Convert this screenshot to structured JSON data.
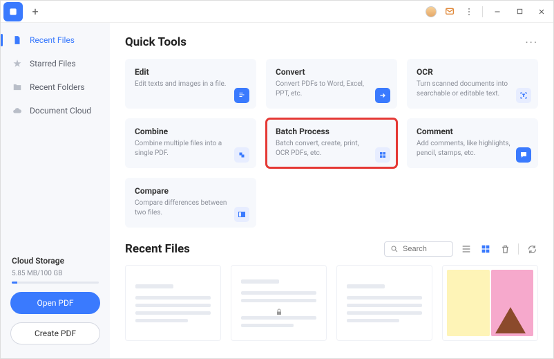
{
  "sidebar": {
    "items": [
      {
        "label": "Recent Files"
      },
      {
        "label": "Starred Files"
      },
      {
        "label": "Recent Folders"
      },
      {
        "label": "Document Cloud"
      }
    ],
    "storage_title": "Cloud Storage",
    "storage_sub": "5.85 MB/100 GB",
    "open_pdf": "Open PDF",
    "create_pdf": "Create PDF"
  },
  "quick_tools": {
    "title": "Quick Tools",
    "tools": [
      {
        "title": "Edit",
        "desc": "Edit texts and images in a file."
      },
      {
        "title": "Convert",
        "desc": "Convert PDFs to Word, Excel, PPT, etc."
      },
      {
        "title": "OCR",
        "desc": "Turn scanned documents into searchable or editable text."
      },
      {
        "title": "Combine",
        "desc": "Combine multiple files into a single PDF."
      },
      {
        "title": "Batch Process",
        "desc": "Batch convert, create, print, OCR PDFs, etc."
      },
      {
        "title": "Comment",
        "desc": "Add comments, like highlights, pencil, stamps, etc."
      },
      {
        "title": "Compare",
        "desc": "Compare differences between two files."
      }
    ]
  },
  "recent_files": {
    "title": "Recent Files",
    "search_placeholder": "Search"
  }
}
